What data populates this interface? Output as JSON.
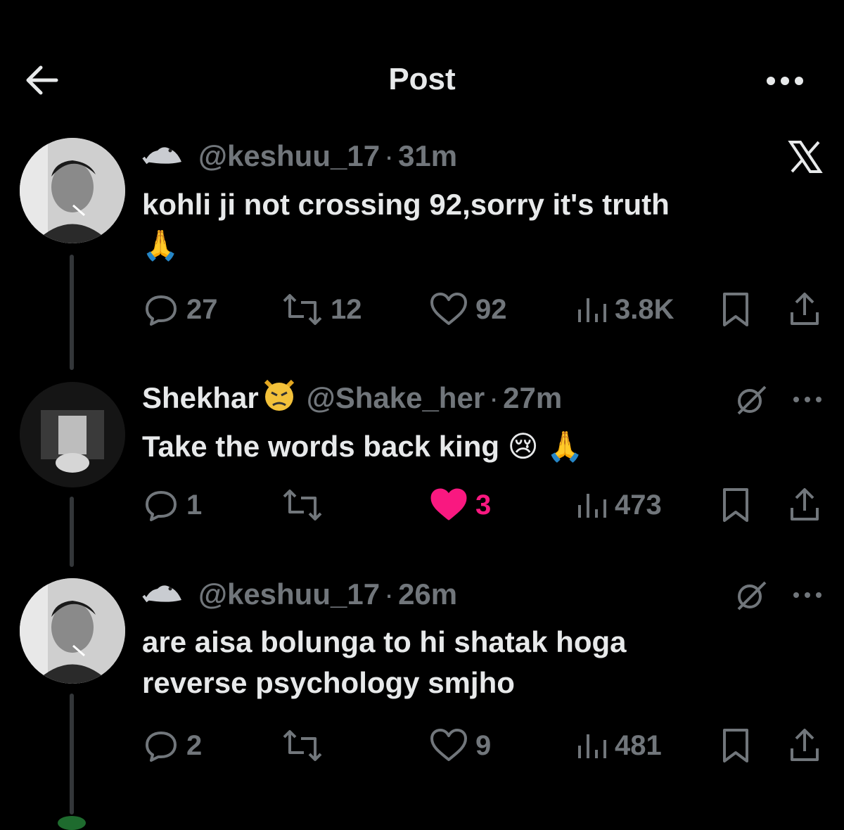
{
  "header": {
    "title": "Post"
  },
  "posts": [
    {
      "name": "",
      "handle": "@keshuu_17",
      "separator": "·",
      "time": "31m",
      "text_lines": [
        "kohli ji not crossing 92,sorry it's truth",
        "🙏"
      ],
      "metrics": {
        "replies": "27",
        "reposts": "12",
        "likes": "92",
        "views": "3.8K"
      },
      "liked": false
    },
    {
      "name": "Shekhar",
      "handle": "@Shake_her",
      "separator": "·",
      "time": "27m",
      "text_lines": [
        "Take the words back king 😢 🙏"
      ],
      "metrics": {
        "replies": "1",
        "reposts": "",
        "likes": "3",
        "views": "473"
      },
      "liked": true
    },
    {
      "name": "",
      "handle": "@keshuu_17",
      "separator": "·",
      "time": "26m",
      "text_lines": [
        "are aisa bolunga to hi shatak hoga",
        "reverse psychology smjho"
      ],
      "metrics": {
        "replies": "2",
        "reposts": "",
        "likes": "9",
        "views": "481"
      },
      "liked": false
    }
  ],
  "colors": {
    "like_active": "#f91880",
    "muted": "#71767b",
    "text": "#e7e9ea",
    "background": "#000000"
  },
  "icons": [
    "back-arrow-icon",
    "more-icon",
    "x-logo-icon",
    "seal-icon",
    "angry-cat-icon",
    "reply-icon",
    "repost-icon",
    "heart-icon",
    "views-icon",
    "bookmark-icon",
    "share-icon",
    "grok-icon"
  ]
}
